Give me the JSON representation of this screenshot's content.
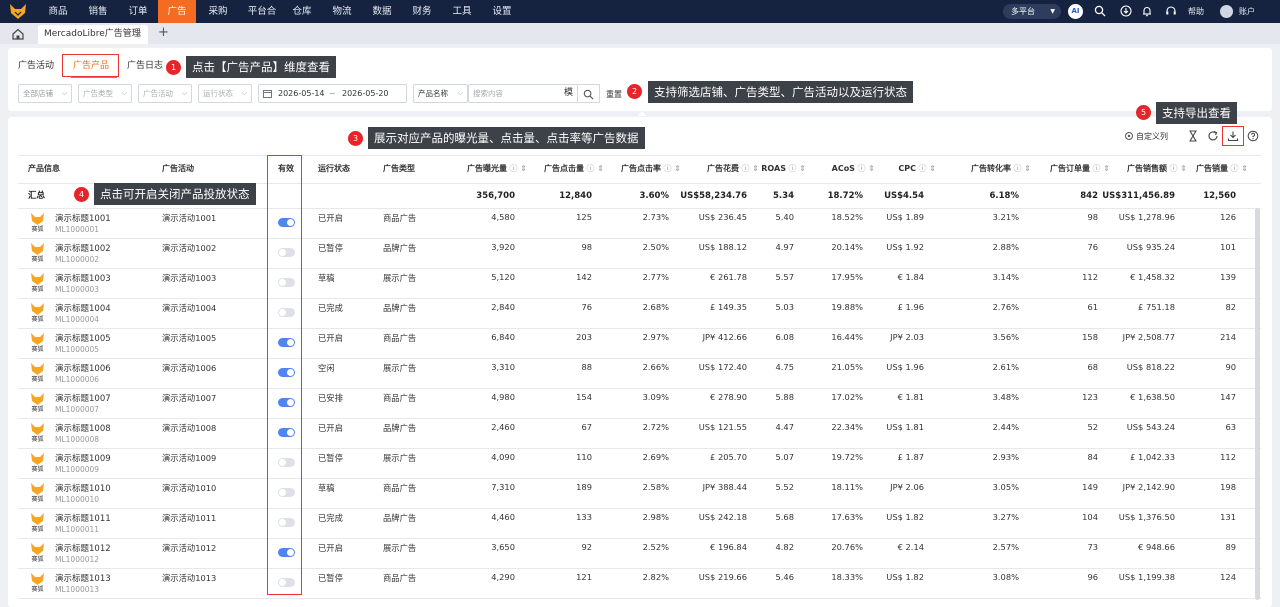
{
  "nav": {
    "items": [
      "商品",
      "销售",
      "订单",
      "广告",
      "采购",
      "平台合",
      "仓库",
      "物流",
      "数据",
      "财务",
      "工具",
      "设置"
    ],
    "active": "广告",
    "platform": "多平台",
    "ai": "AI",
    "help": "帮助",
    "account": "账户"
  },
  "tabbar": {
    "tab_label": "MercadoLibre广告管理",
    "close": "✕",
    "add": "+"
  },
  "subtabs": {
    "campaign": "广告活动",
    "product": "广告产品",
    "log": "广告日志"
  },
  "filters": {
    "store": "全部店铺",
    "ad_type": "广告类型",
    "campaign": "广告活动",
    "status": "运行状态",
    "date_start": "2026-05-14",
    "date_sep": "~",
    "date_end": "2026-05-20",
    "product_name": "产品名称",
    "search_placeholder": "搜索内容",
    "mode": "模",
    "reset": "重置"
  },
  "callouts": [
    {
      "n": "1",
      "text": "点击【广告产品】维度查看"
    },
    {
      "n": "2",
      "text": "支持筛选店铺、广告类型、广告活动以及运行状态"
    },
    {
      "n": "3",
      "text": "展示对应产品的曝光量、点击量、点击率等广告数据"
    },
    {
      "n": "4",
      "text": "点击可开启关闭产品投放状态"
    },
    {
      "n": "5",
      "text": "支持导出查看"
    }
  ],
  "toolbar": {
    "custom_columns": "自定义列"
  },
  "table": {
    "headers": [
      "产品信息",
      "广告活动",
      "有效",
      "运行状态",
      "广告类型",
      "广告曝光量",
      "广告点击量",
      "广告点击率",
      "广告花费",
      "ROAS",
      "ACoS",
      "CPC",
      "广告转化率",
      "广告订单量",
      "广告销售额",
      "广告销量"
    ],
    "summary": {
      "label": "汇总",
      "impressions": "356,700",
      "clicks": "12,840",
      "ctr": "3.60%",
      "spend": "US$58,234.76",
      "roas": "5.34",
      "acos": "18.72%",
      "cpc": "US$4.54",
      "cvr": "6.18%",
      "orders": "842",
      "sales": "US$311,456.89",
      "units": "12,560"
    },
    "rows": [
      {
        "img": "赛狐",
        "name": "演示标题1001",
        "id": "ML1000001",
        "campaign": "演示活动1001",
        "on": true,
        "status": "已开启",
        "type": "商品广告",
        "impressions": "4,580",
        "clicks": "125",
        "ctr": "2.73%",
        "spend": "US$ 236.45",
        "roas": "5.40",
        "acos": "18.52%",
        "cpc": "US$ 1.89",
        "cvr": "3.21%",
        "orders": "98",
        "sales": "US$ 1,278.96",
        "units": "126"
      },
      {
        "img": "赛狐",
        "name": "演示标题1002",
        "id": "ML1000002",
        "campaign": "演示活动1002",
        "on": false,
        "status": "已暂停",
        "type": "品牌广告",
        "impressions": "3,920",
        "clicks": "98",
        "ctr": "2.50%",
        "spend": "US$ 188.12",
        "roas": "4.97",
        "acos": "20.14%",
        "cpc": "US$ 1.92",
        "cvr": "2.88%",
        "orders": "76",
        "sales": "US$ 935.24",
        "units": "101"
      },
      {
        "img": "赛狐",
        "name": "演示标题1003",
        "id": "ML1000003",
        "campaign": "演示活动1003",
        "on": false,
        "status": "草稿",
        "type": "展示广告",
        "impressions": "5,120",
        "clicks": "142",
        "ctr": "2.77%",
        "spend": "€ 261.78",
        "roas": "5.57",
        "acos": "17.95%",
        "cpc": "€ 1.84",
        "cvr": "3.14%",
        "orders": "112",
        "sales": "€ 1,458.32",
        "units": "139"
      },
      {
        "img": "赛狐",
        "name": "演示标题1004",
        "id": "ML1000004",
        "campaign": "演示活动1004",
        "on": false,
        "status": "已完成",
        "type": "品牌广告",
        "impressions": "2,840",
        "clicks": "76",
        "ctr": "2.68%",
        "spend": "£ 149.35",
        "roas": "5.03",
        "acos": "19.88%",
        "cpc": "£ 1.96",
        "cvr": "2.76%",
        "orders": "61",
        "sales": "£ 751.18",
        "units": "82"
      },
      {
        "img": "赛狐",
        "name": "演示标题1005",
        "id": "ML1000005",
        "campaign": "演示活动1005",
        "on": true,
        "status": "已开启",
        "type": "商品广告",
        "impressions": "6,840",
        "clicks": "203",
        "ctr": "2.97%",
        "spend": "JP¥ 412.66",
        "roas": "6.08",
        "acos": "16.44%",
        "cpc": "JP¥ 2.03",
        "cvr": "3.56%",
        "orders": "158",
        "sales": "JP¥ 2,508.77",
        "units": "214"
      },
      {
        "img": "赛狐",
        "name": "演示标题1006",
        "id": "ML1000006",
        "campaign": "演示活动1006",
        "on": true,
        "status": "空闲",
        "type": "展示广告",
        "impressions": "3,310",
        "clicks": "88",
        "ctr": "2.66%",
        "spend": "US$ 172.40",
        "roas": "4.75",
        "acos": "21.05%",
        "cpc": "US$ 1.96",
        "cvr": "2.61%",
        "orders": "68",
        "sales": "US$ 818.22",
        "units": "90"
      },
      {
        "img": "赛狐",
        "name": "演示标题1007",
        "id": "ML1000007",
        "campaign": "演示活动1007",
        "on": true,
        "status": "已安排",
        "type": "商品广告",
        "impressions": "4,980",
        "clicks": "154",
        "ctr": "3.09%",
        "spend": "€ 278.90",
        "roas": "5.88",
        "acos": "17.02%",
        "cpc": "€ 1.81",
        "cvr": "3.48%",
        "orders": "123",
        "sales": "€ 1,638.50",
        "units": "147"
      },
      {
        "img": "赛狐",
        "name": "演示标题1008",
        "id": "ML1000008",
        "campaign": "演示活动1008",
        "on": true,
        "status": "已开启",
        "type": "品牌广告",
        "impressions": "2,460",
        "clicks": "67",
        "ctr": "2.72%",
        "spend": "US$ 121.55",
        "roas": "4.47",
        "acos": "22.34%",
        "cpc": "US$ 1.81",
        "cvr": "2.44%",
        "orders": "52",
        "sales": "US$ 543.24",
        "units": "63"
      },
      {
        "img": "赛狐",
        "name": "演示标题1009",
        "id": "ML1000009",
        "campaign": "演示活动1009",
        "on": false,
        "status": "已暂停",
        "type": "展示广告",
        "impressions": "4,090",
        "clicks": "110",
        "ctr": "2.69%",
        "spend": "£ 205.70",
        "roas": "5.07",
        "acos": "19.72%",
        "cpc": "£ 1.87",
        "cvr": "2.93%",
        "orders": "84",
        "sales": "£ 1,042.33",
        "units": "112"
      },
      {
        "img": "赛狐",
        "name": "演示标题1010",
        "id": "ML1000010",
        "campaign": "演示活动1010",
        "on": false,
        "status": "草稿",
        "type": "商品广告",
        "impressions": "7,310",
        "clicks": "189",
        "ctr": "2.58%",
        "spend": "JP¥ 388.44",
        "roas": "5.52",
        "acos": "18.11%",
        "cpc": "JP¥ 2.06",
        "cvr": "3.05%",
        "orders": "149",
        "sales": "JP¥ 2,142.90",
        "units": "198"
      },
      {
        "img": "赛狐",
        "name": "演示标题1011",
        "id": "ML1000011",
        "campaign": "演示活动1011",
        "on": false,
        "status": "已完成",
        "type": "品牌广告",
        "impressions": "4,460",
        "clicks": "133",
        "ctr": "2.98%",
        "spend": "US$ 242.18",
        "roas": "5.68",
        "acos": "17.63%",
        "cpc": "US$ 1.82",
        "cvr": "3.27%",
        "orders": "104",
        "sales": "US$ 1,376.50",
        "units": "131"
      },
      {
        "img": "赛狐",
        "name": "演示标题1012",
        "id": "ML1000012",
        "campaign": "演示活动1012",
        "on": true,
        "status": "已开启",
        "type": "展示广告",
        "impressions": "3,650",
        "clicks": "92",
        "ctr": "2.52%",
        "spend": "€ 196.84",
        "roas": "4.82",
        "acos": "20.76%",
        "cpc": "€ 2.14",
        "cvr": "2.57%",
        "orders": "73",
        "sales": "€ 948.66",
        "units": "89"
      },
      {
        "img": "赛狐",
        "name": "演示标题1013",
        "id": "ML1000013",
        "campaign": "演示活动1013",
        "on": false,
        "status": "已暂停",
        "type": "商品广告",
        "impressions": "4,290",
        "clicks": "121",
        "ctr": "2.82%",
        "spend": "US$ 219.66",
        "roas": "5.46",
        "acos": "18.33%",
        "cpc": "US$ 1.82",
        "cvr": "3.08%",
        "orders": "96",
        "sales": "US$ 1,199.38",
        "units": "124"
      }
    ]
  }
}
